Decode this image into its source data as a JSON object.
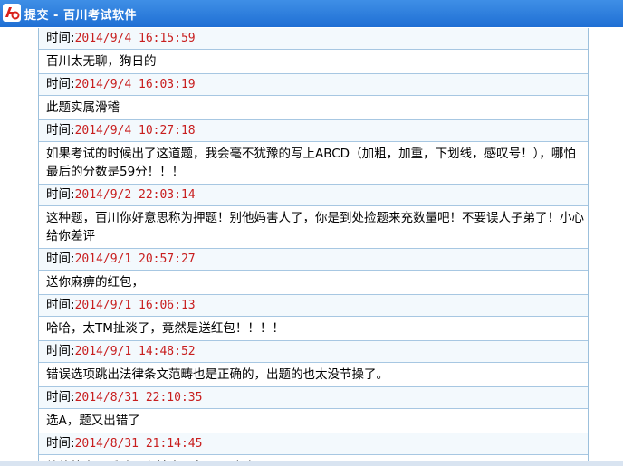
{
  "window": {
    "title": "提交 - 百川考试软件",
    "accent": "#2a7fdc"
  },
  "comments": [
    {
      "time_label": "时间:",
      "time": "2014/9/4 16:15:59",
      "text": "百川太无聊，狗日的"
    },
    {
      "time_label": "时间:",
      "time": "2014/9/4 16:03:19",
      "text": "此题实属滑稽"
    },
    {
      "time_label": "时间:",
      "time": "2014/9/4 10:27:18",
      "text": "如果考试的时候出了这道题，我会毫不犹豫的写上ABCD（加粗，加重，下划线，感叹号！），哪怕最后的分数是59分！！！"
    },
    {
      "time_label": "时间:",
      "time": "2014/9/2 22:03:14",
      "text": "这种题，百川你好意思称为押题！别他妈害人了，你是到处捡题来充数量吧！不要误人子弟了！小心给你差评"
    },
    {
      "time_label": "时间:",
      "time": "2014/9/1 20:57:27",
      "text": "送你麻痹的红包，"
    },
    {
      "time_label": "时间:",
      "time": "2014/9/1 16:06:13",
      "text": "哈哈，太TM扯淡了，竟然是送红包！！！！"
    },
    {
      "time_label": "时间:",
      "time": "2014/9/1 14:48:52",
      "text": "错误选项跳出法律条文范畴也是正确的，出题的也太没节操了。"
    },
    {
      "time_label": "时间:",
      "time": "2014/8/31 22:10:35",
      "text": "选A，题又出错了"
    },
    {
      "time_label": "时间:",
      "time": "2014/8/31 21:14:45",
      "text": "给的答案是反映现在社会现象吗。哈哈"
    }
  ]
}
